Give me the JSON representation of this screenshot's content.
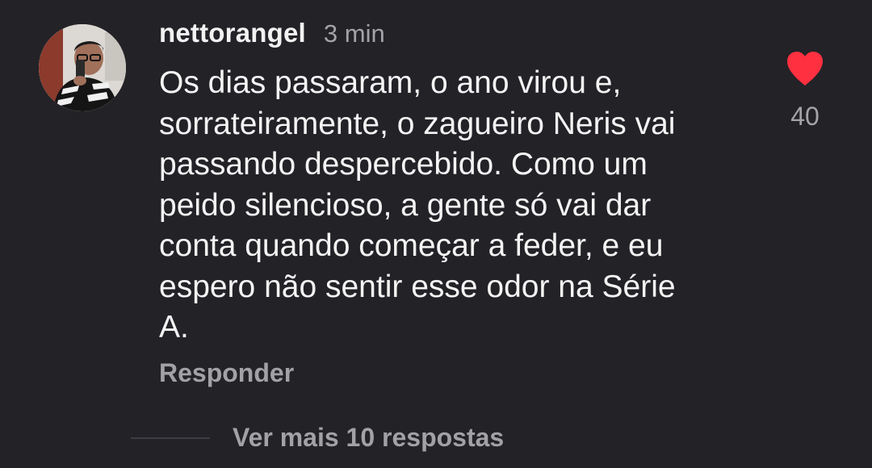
{
  "comment": {
    "username": "nettorangel",
    "timestamp": "3 min",
    "text_lines": [
      "Os dias passaram, o ano virou e,",
      "sorrateiramente, o zagueiro Neris vai",
      "passando despercebido. Como um",
      "peido silencioso, a gente só vai dar",
      "conta quando começar a feder, e eu",
      "espero não sentir esse odor na Série",
      "A."
    ],
    "reply_label": "Responder",
    "like_icon": "heart-icon",
    "like_count": "40",
    "like_color": "#ff3040",
    "liked": true
  },
  "replies": {
    "view_more_label": "Ver mais 10 respostas"
  }
}
